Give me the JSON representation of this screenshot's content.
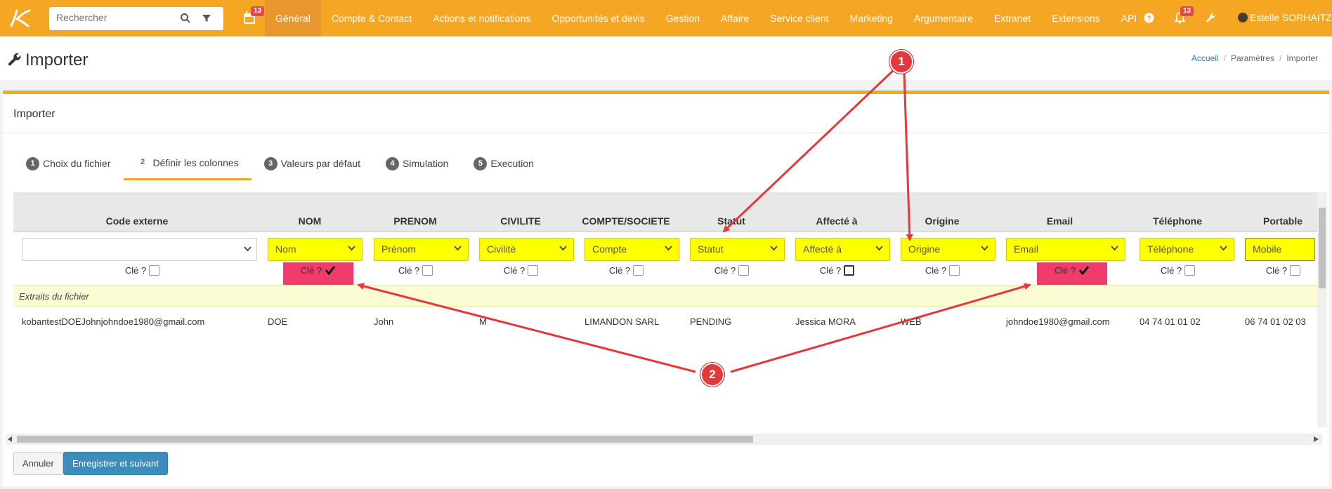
{
  "navbar": {
    "search_placeholder": "Rechercher",
    "calendar_badge": "13",
    "menu": [
      "Général",
      "Compte & Contact",
      "Actions et notifications",
      "Opportunités et devis",
      "Gestion",
      "Affaire",
      "Service client",
      "Marketing",
      "Argumentaire",
      "Extranet",
      "Extensions",
      "API"
    ],
    "active_menu": "Général",
    "notif_badge": "13",
    "user_name": "Estelle SORHAITZ"
  },
  "page": {
    "title": "Importer",
    "breadcrumb": [
      "Accueil",
      "Paramètres",
      "Importer"
    ]
  },
  "panel": {
    "title": "Importer",
    "steps": [
      {
        "num": "1",
        "label": "Choix du fichier"
      },
      {
        "num": "2",
        "label": "Définir les colonnes"
      },
      {
        "num": "3",
        "label": "Valeurs par défaut"
      },
      {
        "num": "4",
        "label": "Simulation"
      },
      {
        "num": "5",
        "label": "Execution"
      }
    ]
  },
  "mapping": {
    "columns": [
      {
        "header": "Code externe",
        "select": "",
        "key_label": "Clé ?",
        "key_checked": false
      },
      {
        "header": "NOM",
        "select": "Nom",
        "key_label": "Clé ?",
        "key_checked": true
      },
      {
        "header": "PRENOM",
        "select": "Prénom",
        "key_label": "Clé ?",
        "key_checked": false
      },
      {
        "header": "CIVILITE",
        "select": "Civilité",
        "key_label": "Clé ?",
        "key_checked": false
      },
      {
        "header": "COMPTE/SOCIETE",
        "select": "Compte",
        "key_label": "Clé ?",
        "key_checked": false
      },
      {
        "header": "Statut",
        "select": "Statut",
        "key_label": "Clé ?",
        "key_checked": false
      },
      {
        "header": "Affecté à",
        "select": "Affecté à",
        "key_label": "Clé ?",
        "key_checked": false
      },
      {
        "header": "Origine",
        "select": "Origine",
        "key_label": "Clé ?",
        "key_checked": false
      },
      {
        "header": "Email",
        "select": "Email",
        "key_label": "Clé ?",
        "key_checked": true
      },
      {
        "header": "Téléphone",
        "select": "Téléphone",
        "key_label": "Clé ?",
        "key_checked": false
      },
      {
        "header": "Portable",
        "select": "Mobile",
        "key_label": "Clé ?",
        "key_checked": false
      }
    ],
    "extraits_label": "Extraits du fichier",
    "row": [
      "kobantestDOEJohnjohndoe1980@gmail.com",
      "DOE",
      "John",
      "M",
      "LIMANDON SARL",
      "PENDING",
      "Jessica MORA",
      "WEB",
      "johndoe1980@gmail.com",
      "04 74 01 01 02",
      "06 74 01 02 03"
    ]
  },
  "buttons": {
    "cancel": "Annuler",
    "save": "Enregistrer et suivant"
  },
  "annotations": {
    "marker1": "1",
    "marker2": "2",
    "color": "#e5383b"
  }
}
